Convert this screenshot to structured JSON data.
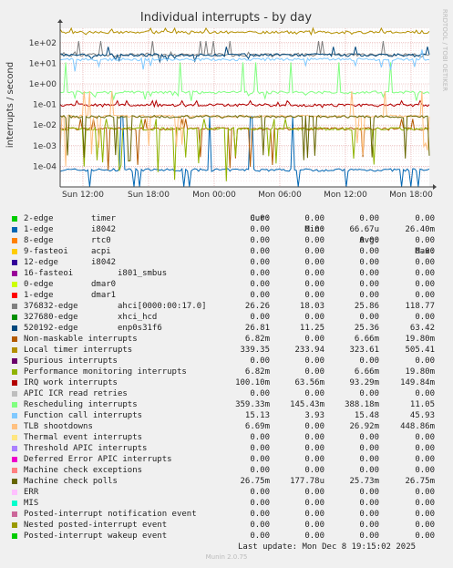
{
  "chart_data": {
    "type": "line",
    "title": "Individual interrupts - by day",
    "ylabel": "interrupts / second",
    "side_label": "RRDTOOL / TOBI OETIKER",
    "y_scale": "log",
    "ylim": [
      1e-05,
      500
    ],
    "y_ticks": [
      "1e+02",
      "1e+01",
      "1e+00",
      "1e-01",
      "1e-02",
      "1e-03",
      "1e-04"
    ],
    "y_tick_values": [
      100,
      10,
      1,
      0.1,
      0.01,
      0.001,
      0.0001
    ],
    "x_ticks": [
      "Sun 12:00",
      "Sun 18:00",
      "Mon 00:00",
      "Mon 06:00",
      "Mon 12:00",
      "Mon 18:00"
    ],
    "grid": true,
    "columns": [
      "Cur:",
      "Min:",
      "Avg:",
      "Max:"
    ],
    "series": [
      {
        "name": "2-edge",
        "device": "timer",
        "color": "#00cc00",
        "cur": "0.00",
        "min": "0.00",
        "avg": "0.00",
        "max": "0.00"
      },
      {
        "name": "1-edge",
        "device": "i8042",
        "color": "#0066b3",
        "cur": "0.00",
        "min": "0.00",
        "avg": "66.67u",
        "max": "26.40m"
      },
      {
        "name": "8-edge",
        "device": "rtc0",
        "color": "#ff8000",
        "cur": "0.00",
        "min": "0.00",
        "avg": "0.00",
        "max": "0.00"
      },
      {
        "name": "9-fasteoi",
        "device": "acpi",
        "color": "#ffcc00",
        "cur": "0.00",
        "min": "0.00",
        "avg": "0.00",
        "max": "0.00"
      },
      {
        "name": "12-edge",
        "device": "i8042",
        "color": "#330099",
        "cur": "0.00",
        "min": "0.00",
        "avg": "0.00",
        "max": "0.00"
      },
      {
        "name": "16-fasteoi",
        "device": "i801_smbus",
        "color": "#990099",
        "cur": "0.00",
        "min": "0.00",
        "avg": "0.00",
        "max": "0.00"
      },
      {
        "name": "0-edge",
        "device": "dmar0",
        "color": "#ccff00",
        "cur": "0.00",
        "min": "0.00",
        "avg": "0.00",
        "max": "0.00"
      },
      {
        "name": "1-edge",
        "device": "dmar1",
        "color": "#ff0000",
        "cur": "0.00",
        "min": "0.00",
        "avg": "0.00",
        "max": "0.00"
      },
      {
        "name": "376832-edge",
        "device": "ahci[0000:00:17.0]",
        "color": "#808080",
        "cur": "26.26",
        "min": "18.03",
        "avg": "25.86",
        "max": "118.77"
      },
      {
        "name": "327680-edge",
        "device": "xhci_hcd",
        "color": "#008f00",
        "cur": "0.00",
        "min": "0.00",
        "avg": "0.00",
        "max": "0.00"
      },
      {
        "name": "520192-edge",
        "device": "enp0s31f6",
        "color": "#00487d",
        "cur": "26.81",
        "min": "11.25",
        "avg": "25.36",
        "max": "63.42"
      },
      {
        "name": "Non-maskable interrupts",
        "device": "",
        "color": "#b35a00",
        "cur": "6.82m",
        "min": "0.00",
        "avg": "6.66m",
        "max": "19.80m"
      },
      {
        "name": "Local timer interrupts",
        "device": "",
        "color": "#b38f00",
        "cur": "339.35",
        "min": "233.94",
        "avg": "323.61",
        "max": "505.41"
      },
      {
        "name": "Spurious interrupts",
        "device": "",
        "color": "#6b006b",
        "cur": "0.00",
        "min": "0.00",
        "avg": "0.00",
        "max": "0.00"
      },
      {
        "name": "Performance monitoring interrupts",
        "device": "",
        "color": "#8fb300",
        "cur": "6.82m",
        "min": "0.00",
        "avg": "6.66m",
        "max": "19.80m"
      },
      {
        "name": "IRQ work interrupts",
        "device": "",
        "color": "#b30000",
        "cur": "100.10m",
        "min": "63.56m",
        "avg": "93.29m",
        "max": "149.84m"
      },
      {
        "name": "APIC ICR read retries",
        "device": "",
        "color": "#bebebe",
        "cur": "0.00",
        "min": "0.00",
        "avg": "0.00",
        "max": "0.00"
      },
      {
        "name": "Rescheduling interrupts",
        "device": "",
        "color": "#80ff80",
        "cur": "359.33m",
        "min": "145.43m",
        "avg": "388.18m",
        "max": "11.05"
      },
      {
        "name": "Function call interrupts",
        "device": "",
        "color": "#80c9ff",
        "cur": "15.13",
        "min": "3.93",
        "avg": "15.48",
        "max": "45.93"
      },
      {
        "name": "TLB shootdowns",
        "device": "",
        "color": "#ffc080",
        "cur": "6.69m",
        "min": "0.00",
        "avg": "26.92m",
        "max": "448.86m"
      },
      {
        "name": "Thermal event interrupts",
        "device": "",
        "color": "#ffe680",
        "cur": "0.00",
        "min": "0.00",
        "avg": "0.00",
        "max": "0.00"
      },
      {
        "name": "Threshold APIC interrupts",
        "device": "",
        "color": "#aa80ff",
        "cur": "0.00",
        "min": "0.00",
        "avg": "0.00",
        "max": "0.00"
      },
      {
        "name": "Deferred Error APIC interrupts",
        "device": "",
        "color": "#ee00cc",
        "cur": "0.00",
        "min": "0.00",
        "avg": "0.00",
        "max": "0.00"
      },
      {
        "name": "Machine check exceptions",
        "device": "",
        "color": "#ff8080",
        "cur": "0.00",
        "min": "0.00",
        "avg": "0.00",
        "max": "0.00"
      },
      {
        "name": "Machine check polls",
        "device": "",
        "color": "#666600",
        "cur": "26.75m",
        "min": "177.78u",
        "avg": "25.73m",
        "max": "26.75m"
      },
      {
        "name": "ERR",
        "device": "",
        "color": "#ffbfff",
        "cur": "0.00",
        "min": "0.00",
        "avg": "0.00",
        "max": "0.00"
      },
      {
        "name": "MIS",
        "device": "",
        "color": "#00ffcc",
        "cur": "0.00",
        "min": "0.00",
        "avg": "0.00",
        "max": "0.00"
      },
      {
        "name": "Posted-interrupt notification event",
        "device": "",
        "color": "#cc6699",
        "cur": "0.00",
        "min": "0.00",
        "avg": "0.00",
        "max": "0.00"
      },
      {
        "name": "Nested posted-interrupt event",
        "device": "",
        "color": "#999900",
        "cur": "0.00",
        "min": "0.00",
        "avg": "0.00",
        "max": "0.00"
      },
      {
        "name": "Posted-interrupt wakeup event",
        "device": "",
        "color": "#00cc00",
        "cur": "0.00",
        "min": "0.00",
        "avg": "0.00",
        "max": "0.00"
      }
    ]
  },
  "footer": {
    "last_update": "Last update: Mon Dec  8 19:15:02 2025",
    "brand": "Munin 2.0.75"
  }
}
